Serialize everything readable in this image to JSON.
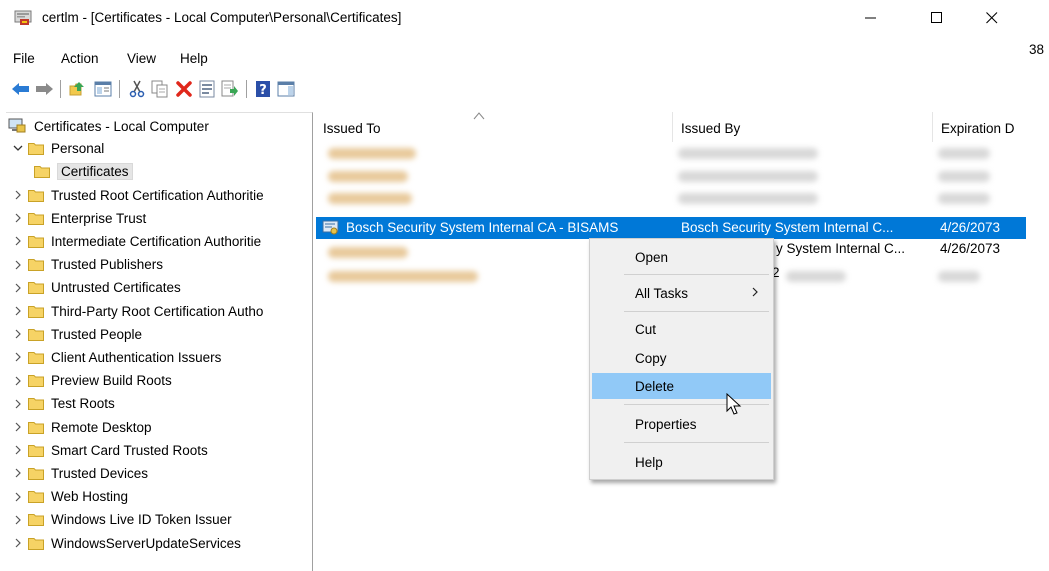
{
  "window": {
    "title": "certlm - [Certificates - Local Computer\\Personal\\Certificates]",
    "side_number": "38"
  },
  "menu": [
    "File",
    "Action",
    "View",
    "Help"
  ],
  "toolbar": {
    "buttons": [
      "back-icon",
      "forward-icon",
      "up-folder-icon",
      "show-hide-tree-icon",
      "cut-icon",
      "copy-icon",
      "delete-icon",
      "properties-icon",
      "export-list-icon",
      "help-icon",
      "action-pane-icon"
    ]
  },
  "tree": {
    "root": "Certificates - Local Computer",
    "personal": "Personal",
    "certificates": "Certificates",
    "items": [
      "Trusted Root Certification Authoritie",
      "Enterprise Trust",
      "Intermediate Certification Authoritie",
      "Trusted Publishers",
      "Untrusted Certificates",
      "Third-Party Root Certification Autho",
      "Trusted People",
      "Client Authentication Issuers",
      "Preview Build Roots",
      "Test Roots",
      "Remote Desktop",
      "Smart Card Trusted Roots",
      "Trusted Devices",
      "Web Hosting",
      "Windows Live ID Token Issuer",
      "WindowsServerUpdateServices"
    ]
  },
  "list": {
    "columns": [
      "Issued To",
      "Issued By",
      "Expiration D"
    ],
    "selected_row": {
      "issued_to": "Bosch Security System Internal CA - BISAMS",
      "issued_by": "Bosch Security System Internal C...",
      "expiration": "4/26/2073"
    },
    "partial_text": {
      "row5_by": "y System Internal C...",
      "row5_exp": "4/26/2073",
      "row6_by": "2"
    }
  },
  "context_menu": {
    "open": "Open",
    "all_tasks": "All Tasks",
    "cut": "Cut",
    "copy": "Copy",
    "delete": "Delete",
    "properties": "Properties",
    "help": "Help",
    "highlighted": "Delete"
  },
  "colors": {
    "selection": "#0078d7",
    "menu_highlight": "#91c9f7",
    "folder": "#f6d365"
  }
}
